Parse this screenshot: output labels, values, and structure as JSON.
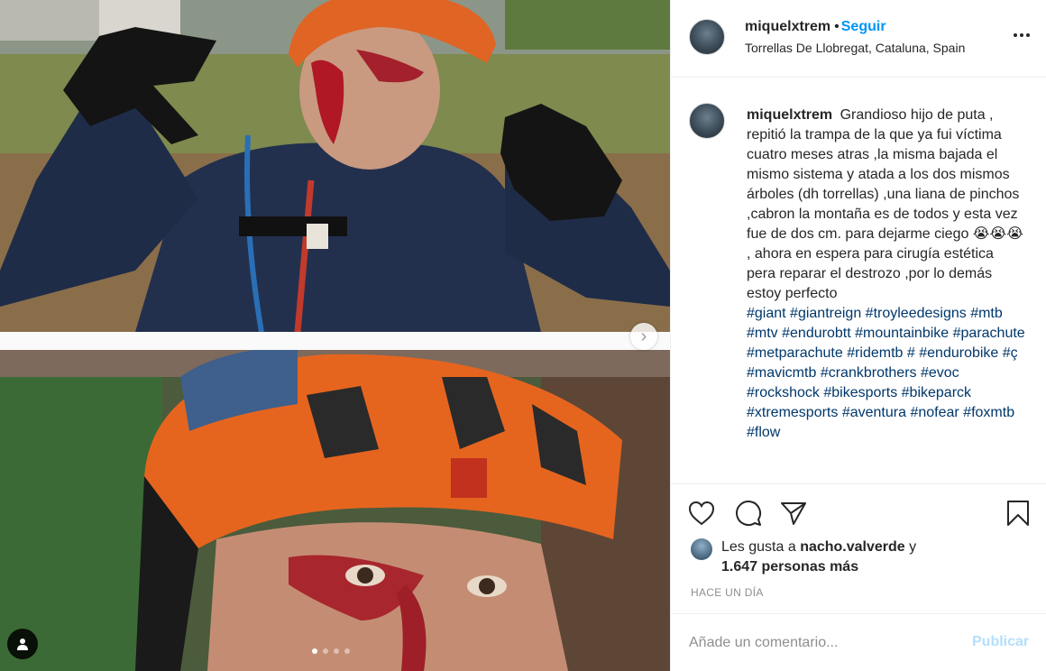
{
  "post": {
    "username": "miquelxtrem",
    "separator": "•",
    "follow_label": "Seguir",
    "location": "Torrellas De Llobregat, Cataluna, Spain",
    "more_icon": "more-horizontal-icon"
  },
  "caption": {
    "username": "miquelxtrem",
    "text": "Grandioso hijo de puta , repitió la trampa de la que ya fui víctima cuatro meses atras ,la misma bajada el mismo sistema y atada a los dos mismos árboles (dh torrellas) ,una liana de pinchos ,cabron la montaña es de todos y esta vez fue de dos cm. para dejarme ciego 😭😭😭 , ahora en espera para cirugía estética pera reparar el destrozo ,por lo demás estoy perfecto",
    "hashtags": [
      "#giant",
      "#giantreign",
      "#troyleedesigns",
      "#mtb",
      "#mtv",
      "#endurobtt",
      "#mountainbike",
      "#parachute",
      "#metparachute",
      "#ridemtb",
      "#",
      "#endurobike",
      "#ç",
      "#mavicmtb",
      "#crankbrothers",
      "#evoc",
      "#rockshock",
      "#bikesports",
      "#bikeparck",
      "#xtremesports",
      "#aventura",
      "#nofear",
      "#foxmtb",
      "#flow"
    ]
  },
  "actions": {
    "like_icon": "heart-icon",
    "comment_icon": "comment-icon",
    "share_icon": "share-icon",
    "save_icon": "bookmark-icon"
  },
  "likes": {
    "prefix": "Les gusta a",
    "first_liker": "nacho.valverde",
    "conjunction": "y",
    "others": "1.647 personas más"
  },
  "timestamp": "HACE UN DÍA",
  "comment": {
    "placeholder": "Añade un comentario...",
    "publish_label": "Publicar"
  },
  "carousel": {
    "slide_count": 4,
    "active_index": 0,
    "next_icon": "chevron-right-icon"
  },
  "colors": {
    "accent": "#0095f6",
    "hashtag": "#00376b",
    "muted": "#8e8e8e",
    "publish_disabled": "#b2dffc"
  }
}
